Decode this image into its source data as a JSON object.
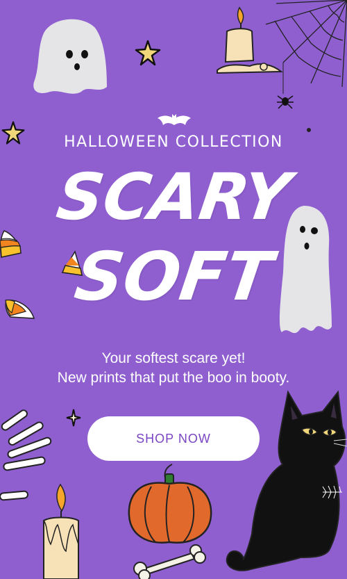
{
  "header": {
    "kicker": "HALLOWEEN COLLECTION"
  },
  "hero": {
    "line1": "SCARY",
    "line2": "SOFT"
  },
  "body": {
    "line1": "Your softest scare yet!",
    "line2": "New prints that put the boo in booty."
  },
  "cta": {
    "label": "SHOP NOW"
  },
  "colors": {
    "background": "#8f5fd0",
    "button_text": "#7a45c4",
    "button_bg": "#ffffff"
  },
  "decorations": [
    "ghost-icon",
    "candle-icon",
    "spiderweb-icon",
    "spider-icon",
    "star-icon",
    "candy-corn-icon",
    "skeleton-hand-icon",
    "pumpkin-icon",
    "bone-icon",
    "black-cat-icon",
    "bat-icon"
  ]
}
